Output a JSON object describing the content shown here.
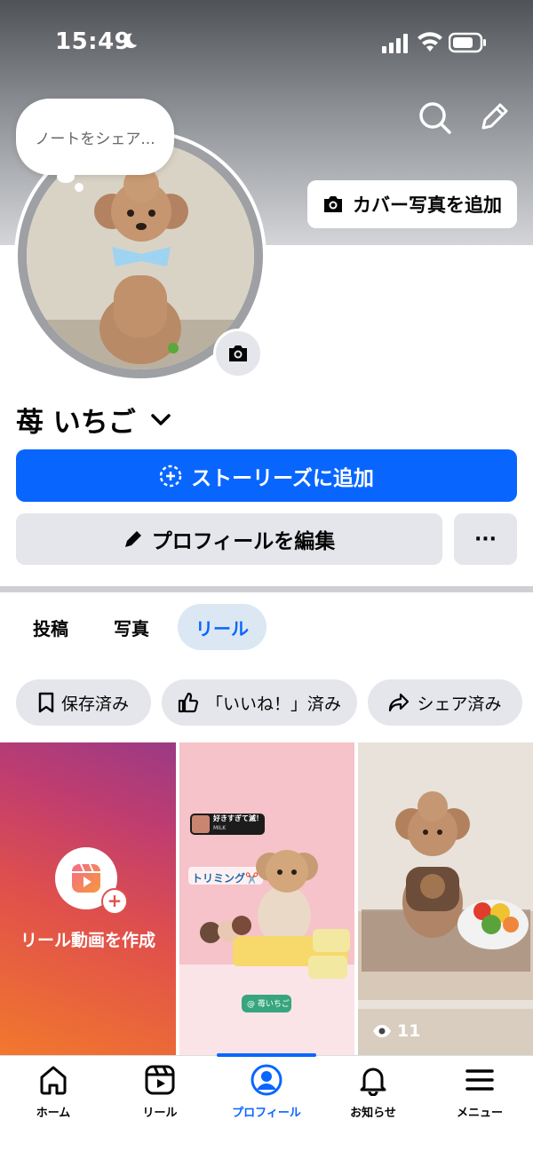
{
  "status_bar": {
    "time": "15:49"
  },
  "header": {
    "add_cover_label": "カバー写真を追加"
  },
  "note": {
    "placeholder": "ノートをシェア..."
  },
  "profile": {
    "name": "苺 いちご"
  },
  "buttons": {
    "add_story": "ストーリーズに追加",
    "edit_profile": "プロフィールを編集",
    "more": "···"
  },
  "tabs": [
    {
      "label": "投稿"
    },
    {
      "label": "写真"
    },
    {
      "label": "リール",
      "active": true
    }
  ],
  "filters": [
    {
      "label": "保存済み",
      "icon": "bookmark-icon"
    },
    {
      "label": "「いいね！」済み",
      "icon": "thumbs-up-icon"
    },
    {
      "label": "シェア済み",
      "icon": "share-icon"
    }
  ],
  "reels": {
    "create_label": "リール動画を作成",
    "reel2": {
      "caption_title": "好きすぎて滅！",
      "caption_sub": "MILK",
      "sticker": "トリミング✂️",
      "tag": "@ 苺いちご"
    },
    "reel3": {
      "views": "11"
    }
  },
  "bottom_nav": [
    {
      "label": "ホーム",
      "icon": "home-icon"
    },
    {
      "label": "リール",
      "icon": "reels-icon"
    },
    {
      "label": "プロフィール",
      "icon": "profile-icon",
      "active": true
    },
    {
      "label": "お知らせ",
      "icon": "bell-icon"
    },
    {
      "label": "メニュー",
      "icon": "menu-icon"
    }
  ],
  "colors": {
    "accent": "#0866ff",
    "chip_bg": "#e4e6eb",
    "active_tab_bg": "#dbe7f2"
  }
}
